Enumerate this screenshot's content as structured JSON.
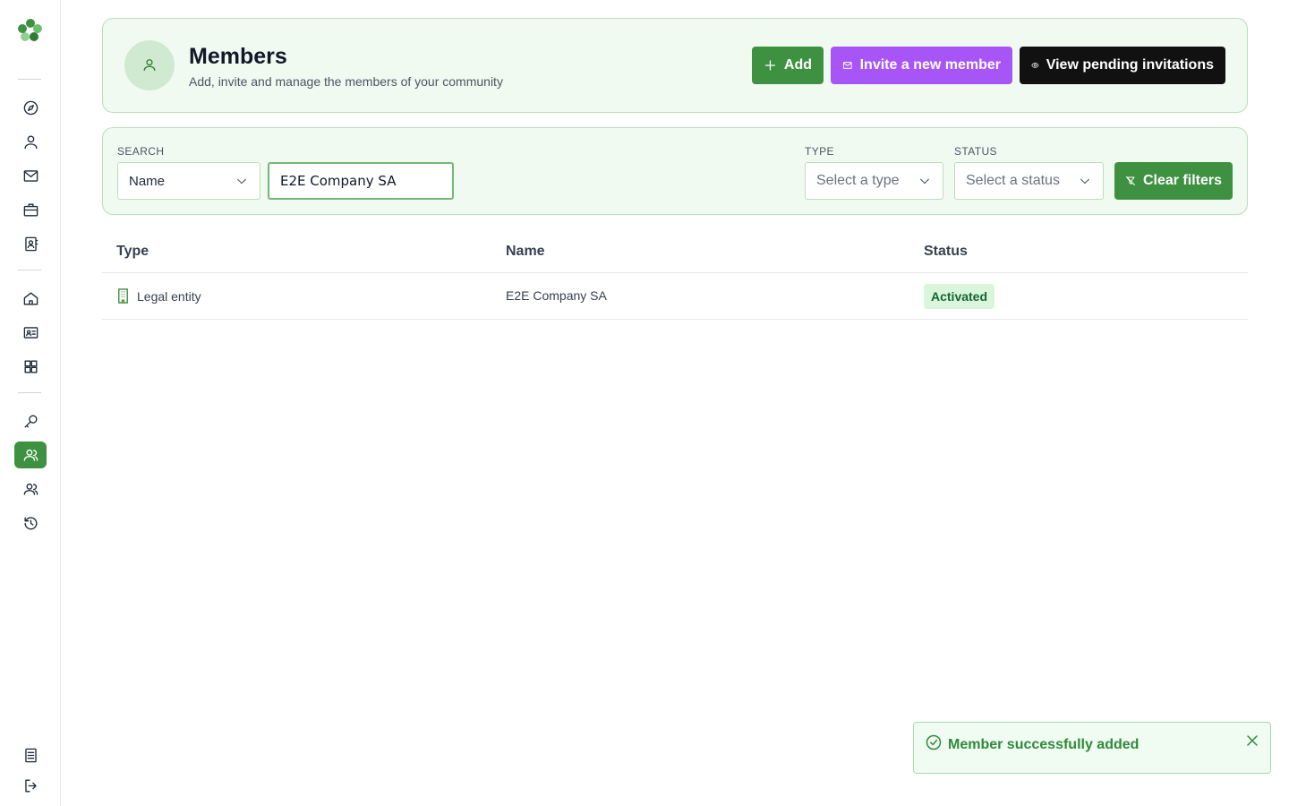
{
  "header": {
    "title": "Members",
    "subtitle": "Add, invite and manage the members of your community",
    "add_label": "Add",
    "invite_label": "Invite a new member",
    "pending_label": "View pending invitations"
  },
  "filters": {
    "search_label": "SEARCH",
    "search_field_value": "Name",
    "search_value": "E2E Company SA",
    "type_label": "TYPE",
    "type_placeholder": "Select a type",
    "status_label": "STATUS",
    "status_placeholder": "Select a status",
    "clear_label": "Clear filters"
  },
  "table": {
    "columns": [
      "Type",
      "Name",
      "Status"
    ],
    "rows": [
      {
        "type": "Legal entity",
        "name": "E2E Company SA",
        "status": "Activated"
      }
    ]
  },
  "toast": {
    "message": "Member successfully added"
  },
  "colors": {
    "primary": "#3f9142",
    "invite": "#a855f7",
    "dark": "#111111",
    "card_bg": "#f1faf1"
  },
  "sidebar": {
    "icons": [
      "compass-icon",
      "user-icon",
      "mail-icon",
      "briefcase-icon",
      "contact-book-icon",
      "home-icon",
      "id-card-icon",
      "grid-icon",
      "key-icon",
      "members-icon",
      "group-icon",
      "history-icon",
      "document-icon",
      "logout-icon"
    ],
    "active": "members-icon"
  }
}
